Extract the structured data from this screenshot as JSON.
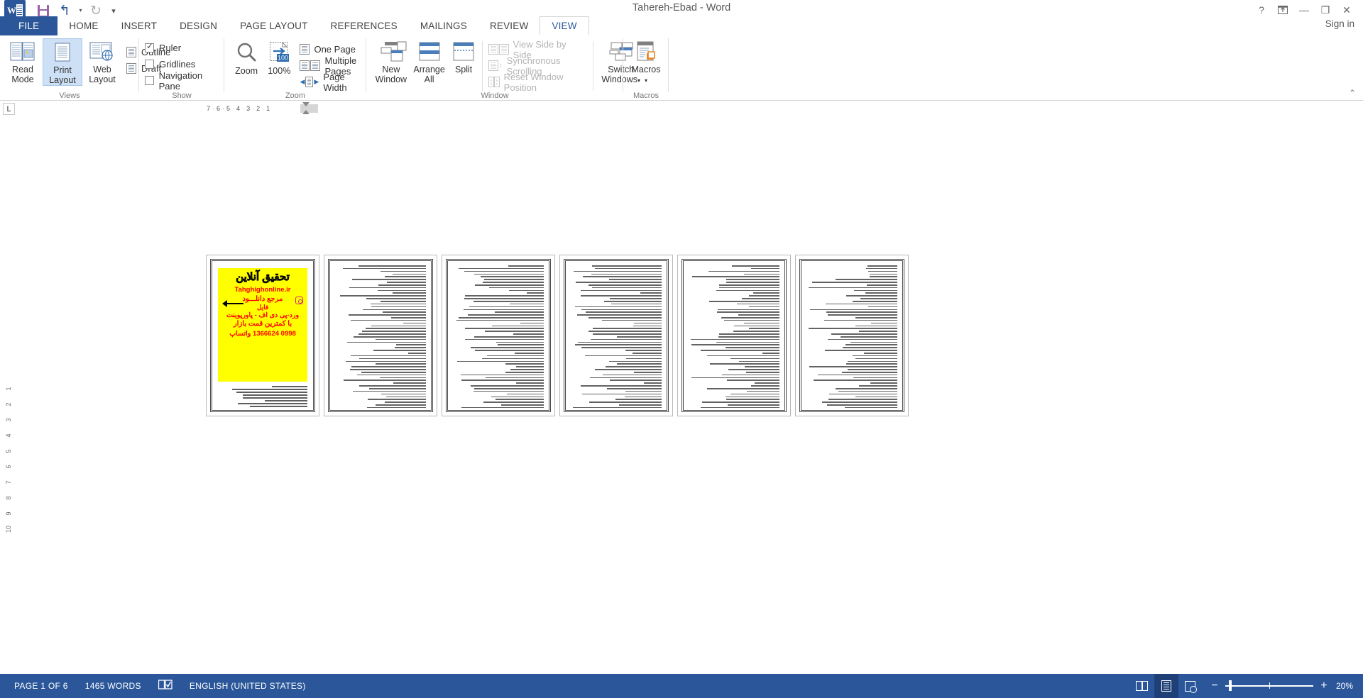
{
  "window": {
    "title": "Tahereh-Ebad - Word",
    "signin": "Sign in",
    "help_icon": "?",
    "ribbon_display_icon": "ribbon-display-options-icon",
    "minimize_icon": "—",
    "restore_icon": "❐",
    "close_icon": "✕"
  },
  "qat": {
    "app_icon": "word-logo-icon",
    "save_icon": "save-icon",
    "undo_icon": "undo-icon",
    "redo_icon": "redo-icon",
    "customize_icon": "customize-quick-access-toolbar-icon",
    "undo_glyph": "↰",
    "redo_glyph": "↻",
    "caret": "▾",
    "more": "▾"
  },
  "tabs": [
    {
      "label": "FILE",
      "state": "file"
    },
    {
      "label": "HOME",
      "state": "normal"
    },
    {
      "label": "INSERT",
      "state": "normal"
    },
    {
      "label": "DESIGN",
      "state": "normal"
    },
    {
      "label": "PAGE LAYOUT",
      "state": "normal"
    },
    {
      "label": "REFERENCES",
      "state": "normal"
    },
    {
      "label": "MAILINGS",
      "state": "normal"
    },
    {
      "label": "REVIEW",
      "state": "normal"
    },
    {
      "label": "VIEW",
      "state": "active"
    }
  ],
  "ribbon": {
    "groups": {
      "views": {
        "label": "Views",
        "buttons": [
          {
            "line1": "Read",
            "line2": "Mode",
            "selected": false
          },
          {
            "line1": "Print",
            "line2": "Layout",
            "selected": true
          },
          {
            "line1": "Web",
            "line2": "Layout",
            "selected": false
          }
        ],
        "checks": [
          {
            "label": "Outline",
            "checked": false
          },
          {
            "label": "Draft",
            "checked": false
          }
        ]
      },
      "show": {
        "label": "Show",
        "checks": [
          {
            "label": "Ruler",
            "checked": true
          },
          {
            "label": "Gridlines",
            "checked": false
          },
          {
            "label": "Navigation Pane",
            "checked": false
          }
        ]
      },
      "zoom": {
        "label": "Zoom",
        "zoom_button": "Zoom",
        "hundred_button": "100%",
        "hundred_badge": "100",
        "items": [
          {
            "label": "One Page"
          },
          {
            "label": "Multiple Pages"
          },
          {
            "label": "Page Width"
          }
        ]
      },
      "window": {
        "label": "Window",
        "buttons": [
          {
            "line1": "New",
            "line2": "Window"
          },
          {
            "line1": "Arrange",
            "line2": "All"
          },
          {
            "line1": "Split",
            "line2": ""
          }
        ],
        "items": [
          {
            "label": "View Side by Side",
            "disabled": true
          },
          {
            "label": "Synchronous Scrolling",
            "disabled": true
          },
          {
            "label": "Reset Window Position",
            "disabled": true
          }
        ],
        "switch_windows": {
          "line1": "Switch",
          "line2": "Windows",
          "caret": "▾"
        }
      },
      "macros": {
        "label": "Macros",
        "button": {
          "line1": "Macros",
          "line2": "",
          "caret": "▾"
        }
      }
    },
    "collapse_icon": "⌃"
  },
  "ruler": {
    "tab_stop_marker": "L",
    "horizontal_ticks": [
      "7",
      "6",
      "5",
      "4",
      "3",
      "2",
      "1"
    ],
    "vertical_ticks": [
      "1",
      "2",
      "3",
      "4",
      "5",
      "6",
      "7",
      "8",
      "9",
      "10"
    ],
    "dot": "⌐"
  },
  "document": {
    "cover": {
      "headline": "تحقیق آنلاین",
      "site": "Tahghighonline.ir",
      "line3": "مرجع دانلـــود",
      "line4": "فایل",
      "line5": "ورد-پی دی اف - پاورپوینت",
      "line6": "با کمترین قمت بازار",
      "line7": "0998 1366624 واتساپ",
      "arrow_icon": "left-arrow-icon",
      "instagram_icon": "instagram-icon",
      "banner_color": "#ffff00",
      "text_color": "#ff0000"
    },
    "page_count": 6,
    "pages": [
      {
        "number": 1,
        "type": "cover"
      },
      {
        "number": 2,
        "type": "text"
      },
      {
        "number": 3,
        "type": "text"
      },
      {
        "number": 4,
        "type": "text"
      },
      {
        "number": 5,
        "type": "text"
      },
      {
        "number": 6,
        "type": "text"
      }
    ]
  },
  "statusbar": {
    "page_label": "PAGE 1 OF 6",
    "word_count": "1465 WORDS",
    "proofing_icon": "proofing-errors-icon",
    "language": "ENGLISH (UNITED STATES)",
    "view_read_icon": "read-mode-view-icon",
    "view_print_icon": "print-layout-view-icon",
    "view_web_icon": "web-layout-view-icon",
    "zoom_out": "−",
    "zoom_in": "+",
    "zoom_level": "20%"
  }
}
